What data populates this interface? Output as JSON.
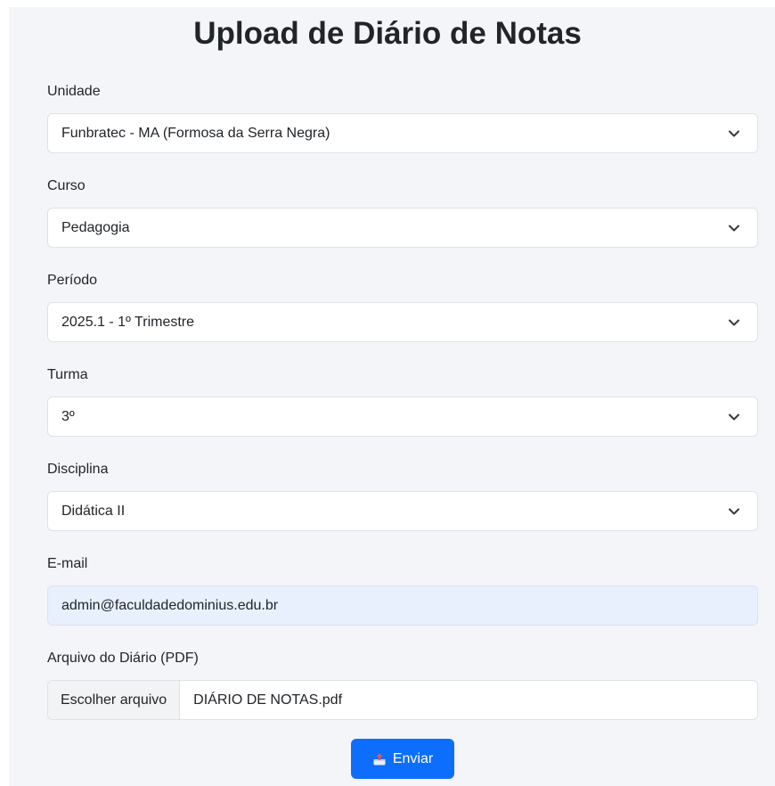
{
  "page_title": "Upload de Diário de Notas",
  "fields": {
    "unidade": {
      "label": "Unidade",
      "value": "Funbratec - MA (Formosa da Serra Negra)"
    },
    "curso": {
      "label": "Curso",
      "value": "Pedagogia"
    },
    "periodo": {
      "label": "Período",
      "value": "2025.1 - 1º Trimestre"
    },
    "turma": {
      "label": "Turma",
      "value": "3º"
    },
    "disciplina": {
      "label": "Disciplina",
      "value": "Didática II"
    },
    "email": {
      "label": "E-mail",
      "value": "admin@faculdadedominius.edu.br"
    },
    "arquivo": {
      "label": "Arquivo do Diário (PDF)",
      "button": "Escolher arquivo",
      "filename": "DIÁRIO DE NOTAS.pdf"
    }
  },
  "submit": {
    "label": "Enviar",
    "icon": "inbox-upload-icon"
  },
  "colors": {
    "primary": "#0d6efd",
    "autofill": "#e8f0fe",
    "background": "#f4f5f8"
  }
}
